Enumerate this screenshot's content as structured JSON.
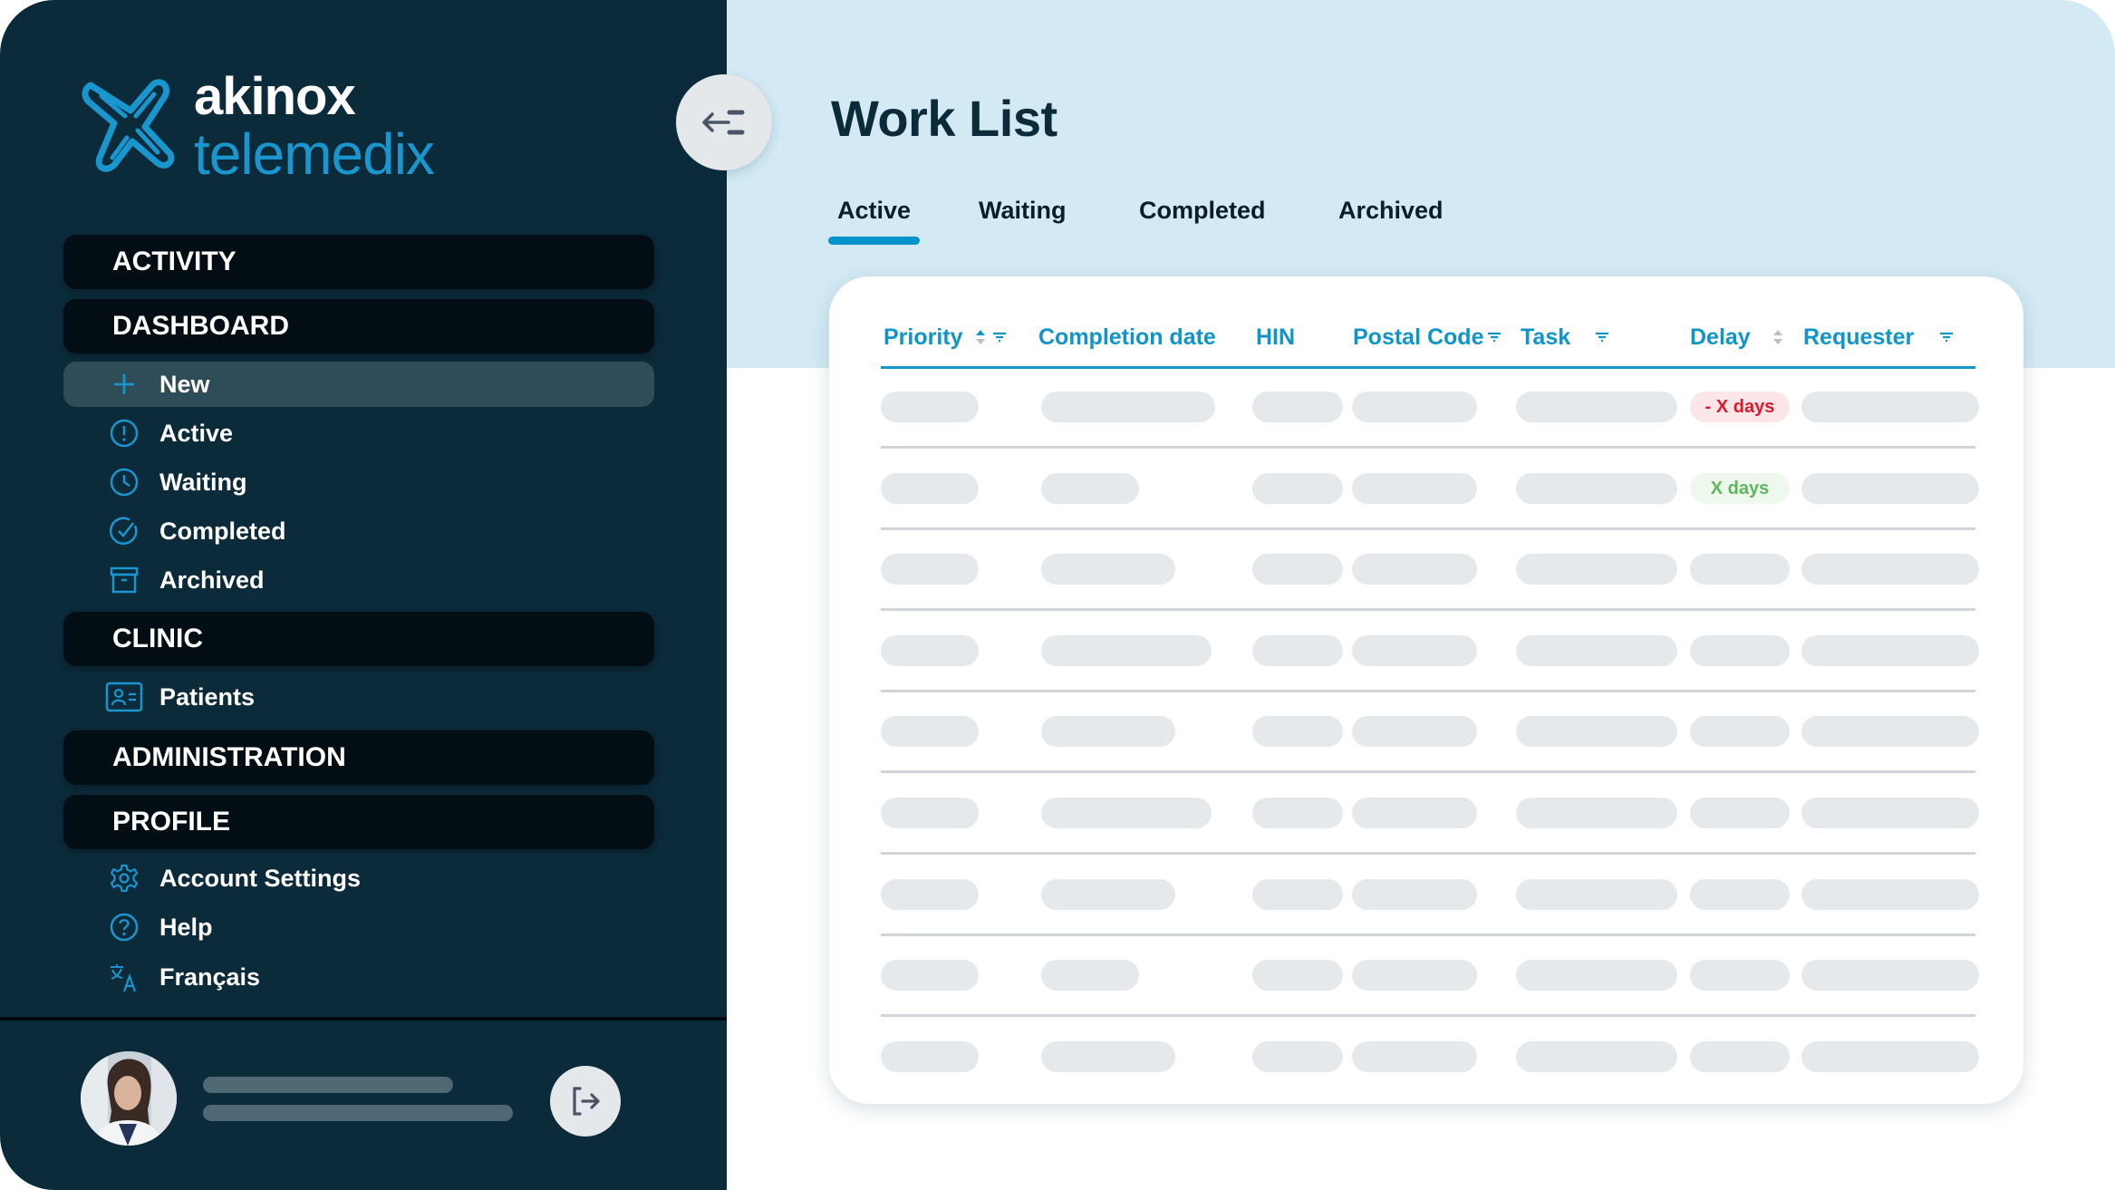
{
  "brand": {
    "name_line1": "akinox",
    "name_line2": "telemedix",
    "accent_color": "#1a96cf"
  },
  "sidebar": {
    "sections": [
      {
        "label": "ACTIVITY"
      },
      {
        "label": "DASHBOARD",
        "items": [
          {
            "label": "New",
            "icon": "plus-icon",
            "selected": true
          },
          {
            "label": "Active",
            "icon": "alert-circle-icon"
          },
          {
            "label": "Waiting",
            "icon": "clock-icon"
          },
          {
            "label": "Completed",
            "icon": "check-circle-icon"
          },
          {
            "label": "Archived",
            "icon": "archive-box-icon"
          }
        ]
      },
      {
        "label": "CLINIC",
        "items": [
          {
            "label": "Patients",
            "icon": "patient-card-icon"
          }
        ]
      },
      {
        "label": "ADMINISTRATION"
      },
      {
        "label": "PROFILE",
        "items": [
          {
            "label": "Account Settings",
            "icon": "gear-icon"
          },
          {
            "label": "Help",
            "icon": "help-circle-icon"
          },
          {
            "label": "Français",
            "icon": "translate-icon"
          }
        ]
      }
    ],
    "user": {
      "avatar": "user-avatar-photo",
      "name_placeholder": "",
      "email_placeholder": ""
    },
    "logout_icon": "logout-icon",
    "collapse_icon": "collapse-menu-icon"
  },
  "main": {
    "title": "Work List",
    "tabs": [
      {
        "label": "Active",
        "active": true
      },
      {
        "label": "Waiting"
      },
      {
        "label": "Completed"
      },
      {
        "label": "Archived"
      }
    ],
    "table": {
      "columns": [
        {
          "label": "Priority",
          "sortable": true,
          "filterable": true
        },
        {
          "label": "Completion date"
        },
        {
          "label": "HIN"
        },
        {
          "label": "Postal Code",
          "filterable": true
        },
        {
          "label": "Task",
          "filterable": true
        },
        {
          "label": "Delay",
          "sortable": true
        },
        {
          "label": "Requester",
          "filterable": true
        }
      ],
      "row_count": 9,
      "loading_placeholders": true,
      "delay_badges": [
        {
          "row": 0,
          "text": "- X days",
          "status": "overdue",
          "text_color": "#e0192a",
          "bg_color": "#fde6e8"
        },
        {
          "row": 1,
          "text": "X days",
          "status": "on-time",
          "text_color": "#5cb85c",
          "bg_color": "#eef8ec"
        }
      ]
    }
  },
  "colors": {
    "sidebar_bg": "#0b2a3a",
    "section_bg": "#020e14",
    "header_band": "#d3eaf4",
    "table_header_text": "#0f95c9",
    "skeleton": "#e5e9eb"
  }
}
